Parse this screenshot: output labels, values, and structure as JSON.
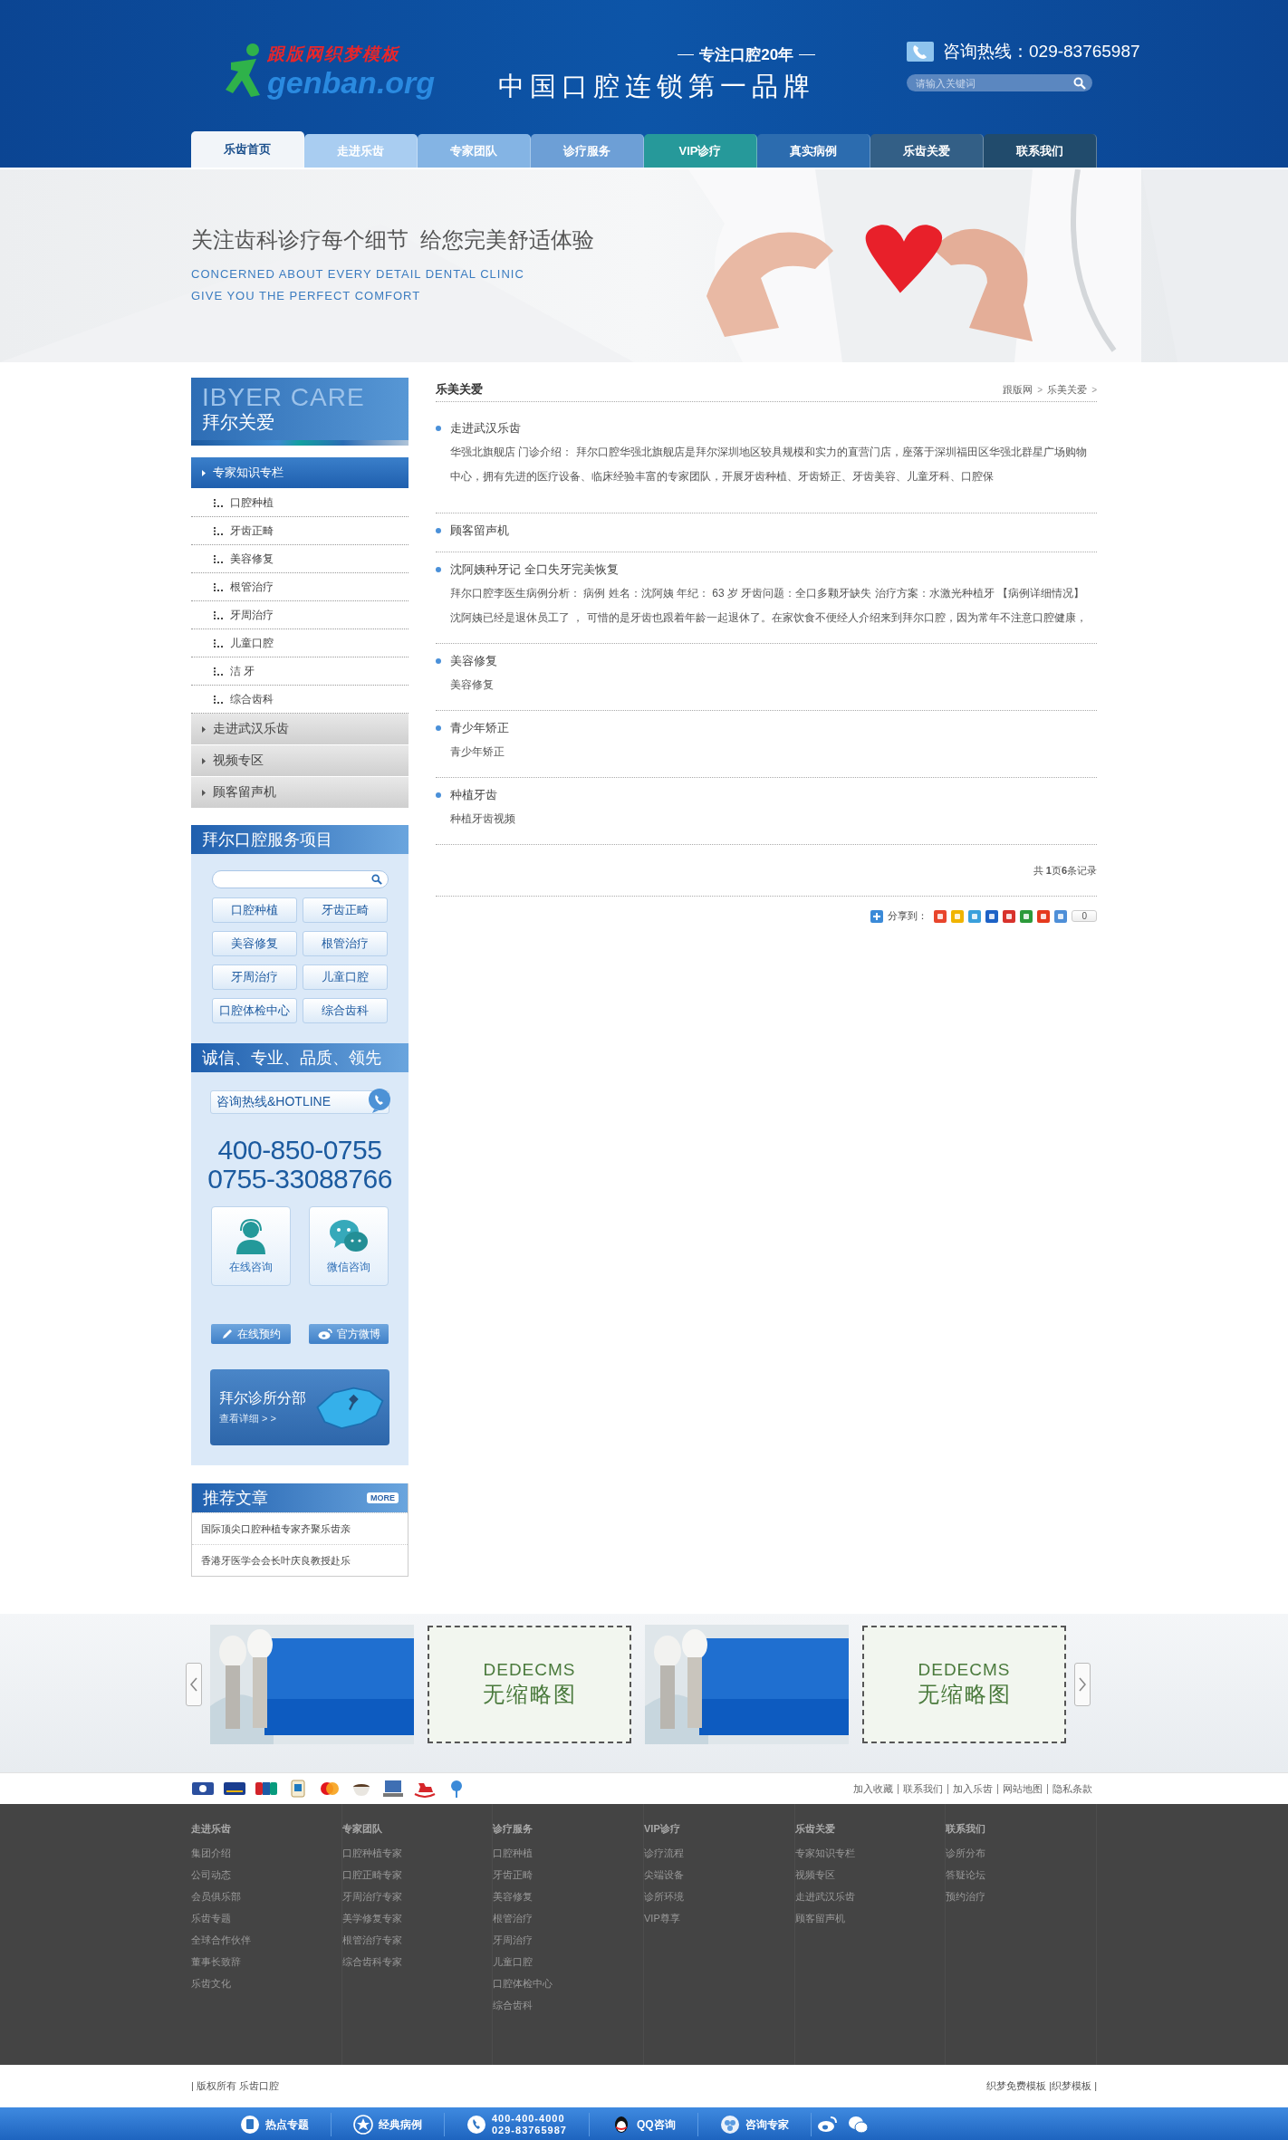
{
  "header": {
    "logo_text": "跟版网织梦模板",
    "logo_domain": "genban.org",
    "slogan_top": "专注口腔20年",
    "slogan": "中国口腔连锁第一品牌",
    "hotline": "咨询热线：029-83765987",
    "search": {
      "placeholder": "请输入关键词"
    }
  },
  "nav": [
    {
      "label": "乐齿首页",
      "selected": true,
      "color": "#f2f5f9"
    },
    {
      "label": "走进乐齿",
      "selected": false,
      "color": "#a9cdf1"
    },
    {
      "label": "专家团队",
      "selected": false,
      "color": "#84b4e4"
    },
    {
      "label": "诊疗服务",
      "selected": false,
      "color": "#6d9fd6"
    },
    {
      "label": "VIP诊疗",
      "selected": false,
      "color": "#26999a"
    },
    {
      "label": "真实病例",
      "selected": false,
      "color": "#2c6caf"
    },
    {
      "label": "乐齿关爱",
      "selected": false,
      "color": "#335f86"
    },
    {
      "label": "联系我们",
      "selected": false,
      "color": "#214b6c"
    }
  ],
  "banner": {
    "headline": "关注齿科诊疗每个细节  给您完美舒适体验",
    "subline_1": "CONCERNED ABOUT EVERY DETAIL DENTAL CLINIC",
    "subline_2": "GIVE YOU THE PERFECT COMFORT"
  },
  "sidebar": {
    "brand_en": "IBYER CARE",
    "brand": "拜尔关爱",
    "menu": [
      {
        "label": "专家知识专栏",
        "selected": true,
        "children": [
          {
            "label": "口腔种植"
          },
          {
            "label": "牙齿正畸"
          },
          {
            "label": "美容修复"
          },
          {
            "label": "根管治疗"
          },
          {
            "label": "牙周治疗"
          },
          {
            "label": "儿童口腔"
          },
          {
            "label": "洁 牙"
          },
          {
            "label": "综合齿科"
          }
        ]
      },
      {
        "label": "走进武汉乐齿",
        "selected": false
      },
      {
        "label": "视频专区",
        "selected": false
      },
      {
        "label": "顾客留声机",
        "selected": false
      }
    ]
  },
  "services": {
    "title": "拜尔口腔服务项目",
    "tags": [
      "口腔种植",
      "牙齿正畸",
      "美容修复",
      "根管治疗",
      "牙周治疗",
      "儿童口腔",
      "口腔体检中心",
      "综合齿科"
    ]
  },
  "hotline_panel": {
    "title": "诚信、专业、品质、领先",
    "label": "咨询热线&HOTLINE",
    "phones": [
      "400-850-0755",
      "0755-33088766"
    ],
    "consult": [
      {
        "kind": "agent",
        "label": "在线咨询"
      },
      {
        "kind": "chat",
        "label": "微信咨询"
      }
    ],
    "actions": [
      {
        "kind": "booking",
        "label": "在线预约"
      },
      {
        "kind": "weibo",
        "label": "官方微博"
      }
    ],
    "branch": {
      "title": "拜尔诊所分部",
      "link": "查看详细 > >"
    }
  },
  "recommended": {
    "title": "推荐文章",
    "more": "MORE",
    "items": [
      "国际顶尖口腔种植专家齐聚乐齿亲",
      "香港牙医学会会长叶庆良教授赴乐"
    ]
  },
  "content": {
    "title": "乐美关爱",
    "breadcrumb": [
      {
        "kind": "link",
        "text": "跟版网"
      },
      {
        "kind": "separator",
        "text": ">"
      },
      {
        "kind": "link",
        "text": "乐美关爱"
      },
      {
        "kind": "separator",
        "text": ">"
      }
    ],
    "articles": [
      {
        "title": "走进武汉乐齿",
        "summary": "华强北旗舰店 门诊介绍： 拜尔口腔华强北旗舰店是拜尔深圳地区较具规模和实力的直营门店，座落于深圳福田区华强北群星广场购物中心，拥有先进的医疗设备、临床经验丰富的专家团队，开展牙齿种植、牙齿矫正、牙齿美容、儿童牙科、口腔保"
      },
      {
        "title": "顾客留声机"
      },
      {
        "title": "沈阿姨种牙记 全口失牙完美恢复",
        "summary": "拜尔口腔李医生病例分析： 病例 姓名：沈阿姨 年纪： 63 岁 牙齿问题：全口多颗牙缺失 治疗方案：水激光种植牙 【病例详细情况】沈阿姨已经是退休员工了 ， 可惜的是牙齿也跟着年龄一起退休了。在家饮食不便经人介绍来到拜尔口腔，因为常年不注意口腔健康，"
      },
      {
        "title": "美容修复",
        "summary": "美容修复"
      },
      {
        "title": "青少年矫正",
        "summary": "青少年矫正"
      },
      {
        "title": "种植牙齿",
        "summary": "种植牙齿视频"
      }
    ],
    "pagination": "共 **1**页**6**条记录",
    "share": {
      "label": "分享到：",
      "count": "0"
    }
  },
  "carousel": [
    {
      "kind": "picture"
    },
    {
      "kind": "placeholder",
      "line_1": "DEDECMS",
      "line_2": "无缩略图"
    },
    {
      "kind": "picture"
    },
    {
      "kind": "placeholder",
      "line_1": "DEDECMS",
      "line_2": "无缩略图"
    }
  ],
  "site_links": [
    "加入收藏",
    "联系我们",
    "加入乐齿",
    "网站地图",
    "隐私条款"
  ],
  "footer": {
    "columns": [
      {
        "title": "走进乐齿",
        "links": [
          "集团介绍",
          "公司动态",
          "会员俱乐部",
          "乐齿专题",
          "全球合作伙伴",
          "董事长致辞",
          "乐齿文化"
        ]
      },
      {
        "title": "专家团队",
        "links": [
          "口腔种植专家",
          "口腔正畸专家",
          "牙周治疗专家",
          "美学修复专家",
          "根管治疗专家",
          "综合齿科专家"
        ]
      },
      {
        "title": "诊疗服务",
        "links": [
          "口腔种植",
          "牙齿正畸",
          "美容修复",
          "根管治疗",
          "牙周治疗",
          "儿童口腔",
          "口腔体检中心",
          "综合齿科"
        ]
      },
      {
        "title": "VIP诊疗",
        "links": [
          "诊疗流程",
          "尖端设备",
          "诊所环境",
          "VIP尊享"
        ]
      },
      {
        "title": "乐齿关爱",
        "links": [
          "专家知识专栏",
          "视频专区",
          "走进武汉乐齿",
          "顾客留声机"
        ]
      },
      {
        "title": "联系我们",
        "links": [
          "诊所分布",
          "答疑论坛",
          "预约治疗"
        ]
      }
    ],
    "copyright": "| 版权所有 乐齿口腔",
    "credits": "织梦免费模板 |织梦模板 |"
  },
  "bottom_bar": [
    {
      "kind": "topic",
      "label": "热点专题"
    },
    {
      "kind": "case",
      "label": "经典病例"
    },
    {
      "kind": "phone",
      "lines": [
        "400-400-4000",
        "029-83765987"
      ]
    },
    {
      "kind": "qq",
      "label": "QQ咨询"
    },
    {
      "kind": "expert",
      "label": "咨询专家"
    },
    {
      "kind": "weibo"
    },
    {
      "kind": "wechat"
    }
  ]
}
